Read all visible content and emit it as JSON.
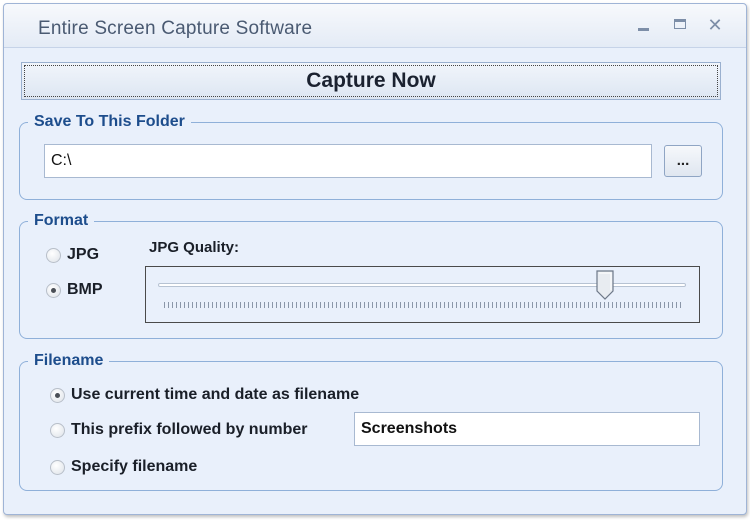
{
  "window": {
    "title": "Entire Screen Capture Software",
    "controls": {
      "minimize": "minimize-icon",
      "maximize": "maximize-icon",
      "close": "close-icon"
    }
  },
  "capture_button": {
    "label": "Capture Now"
  },
  "save_folder": {
    "legend": "Save To This Folder",
    "path_value": "C:\\",
    "browse_label": "..."
  },
  "format": {
    "legend": "Format",
    "options": [
      {
        "label": "JPG",
        "checked": false
      },
      {
        "label": "BMP",
        "checked": true
      }
    ],
    "quality_label": "JPG Quality:",
    "quality_fraction": 0.85
  },
  "filename": {
    "legend": "Filename",
    "options": [
      {
        "label": "Use current time and date as filename",
        "checked": true
      },
      {
        "label": "This prefix followed by number",
        "checked": false
      },
      {
        "label": "Specify filename",
        "checked": false
      }
    ],
    "prefix_value": "Screenshots"
  },
  "colors": {
    "window_bg": "#e9f0fb",
    "group_border": "#8fb0d9",
    "legend_text": "#1d4d8c"
  }
}
